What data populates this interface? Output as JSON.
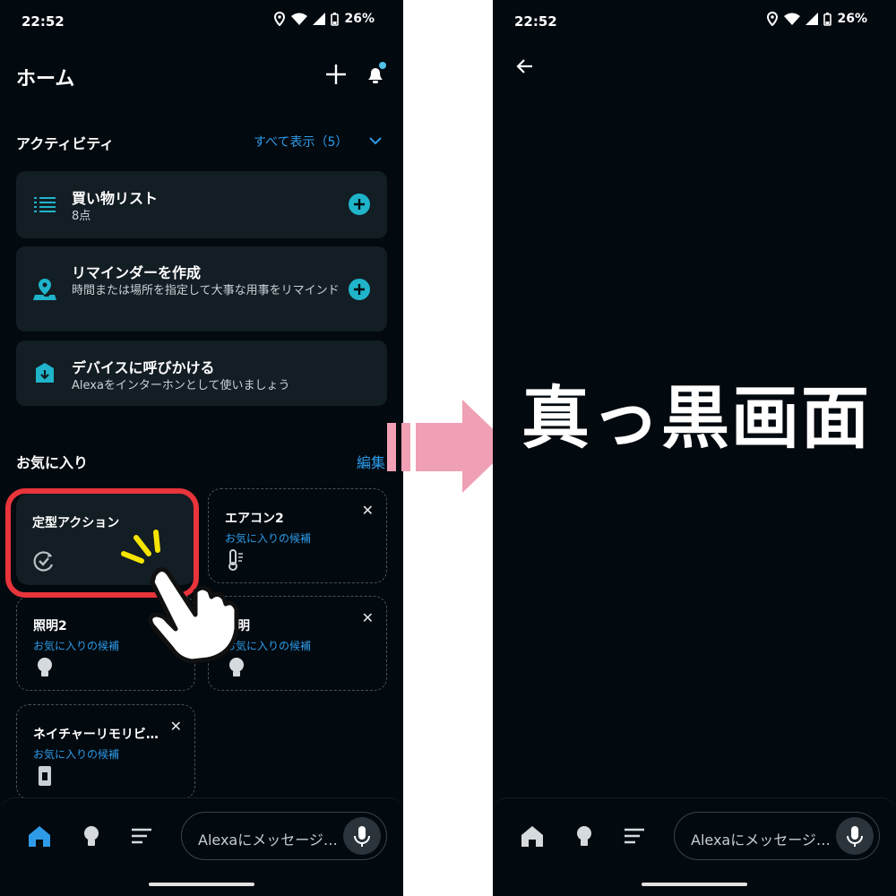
{
  "status": {
    "time": "22:52",
    "battery": "26%"
  },
  "home": {
    "title": "ホーム",
    "activity": {
      "title": "アクティビティ",
      "show_all": "すべて表示（5）",
      "cards": [
        {
          "title": "買い物リスト",
          "subtitle": "8点",
          "icon": "list-icon"
        },
        {
          "title": "リマインダーを作成",
          "subtitle": "時間または場所を指定して大事な用事をリマインド",
          "icon": "location-pin-icon"
        },
        {
          "title": "デバイスに呼びかける",
          "subtitle": "Alexaをインターホンとして使いましょう",
          "icon": "download-icon"
        }
      ]
    },
    "favorites": {
      "title": "お気に入り",
      "edit": "編集",
      "tiles": [
        {
          "title": "定型アクション",
          "subtitle": "",
          "icon": "routine-icon"
        },
        {
          "title": "エアコン2",
          "subtitle": "お気に入りの候補",
          "icon": "thermometer-icon"
        },
        {
          "title": "照明2",
          "subtitle": "お気に入りの候補",
          "icon": "bulb-icon"
        },
        {
          "title": "照明",
          "subtitle": "お気に入りの候補",
          "icon": "bulb-icon"
        },
        {
          "title": "ネイチャーリモリビ…",
          "subtitle": "お気に入りの候補",
          "icon": "remote-icon"
        }
      ]
    }
  },
  "bottom": {
    "message_placeholder": "Alexaにメッセージ…"
  },
  "right": {
    "caption": "真っ黒画面"
  },
  "colors": {
    "background": "#02090f",
    "card": "#131d24",
    "accent": "#2e9be8",
    "teal": "#1fb4c9",
    "highlight": "#e8343b",
    "arrow": "#f0a0b4"
  }
}
